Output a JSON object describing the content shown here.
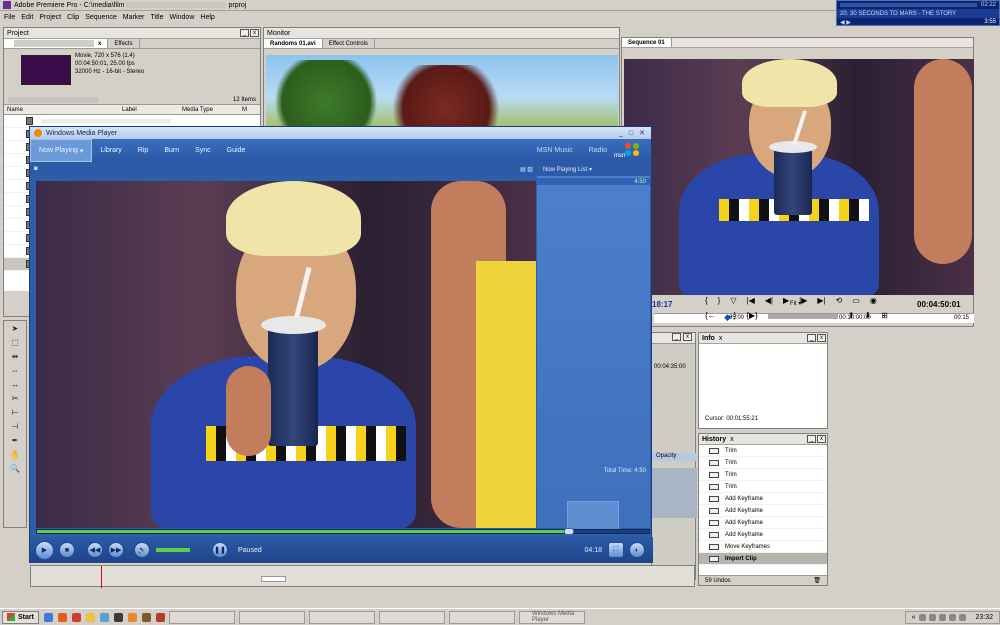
{
  "premiere": {
    "title": "Adobe Premiere Pro - C:\\media\\film",
    "title_tail": "prproj",
    "menu": [
      "File",
      "Edit",
      "Project",
      "Clip",
      "Sequence",
      "Marker",
      "Title",
      "Window",
      "Help"
    ]
  },
  "media_mini": {
    "now_playing": "20. 30 SECONDS TO MARS - THE STORY",
    "time": "3:55",
    "clock": "02:22"
  },
  "project": {
    "title": "Project",
    "tab_effects": "Effects",
    "clip_type": "Movie, 720 x 576 (1.4)",
    "clip_duration": "00:04:50:01, 25.00 fps",
    "clip_audio": "32000 Hz - 16-bit - Stereo",
    "items_count": "12 Items",
    "columns": {
      "name": "Name",
      "label": "Label",
      "media_type": "Media Type",
      "m": "M"
    }
  },
  "monitor": {
    "title": "Monitor",
    "tab_source": "Randoms 01.avi",
    "tab_effect_controls": "Effect Controls"
  },
  "sequence": {
    "tab": "Sequence 01",
    "current_tc": "18:17",
    "fit": "Fit",
    "duration_tc": "00:04:50:01",
    "ruler": [
      "05:00",
      "00:10:00:00",
      "00:15"
    ]
  },
  "timeline_small": {
    "tc": "00:04:35:00",
    "opacity": "Opacity"
  },
  "info": {
    "title": "Info",
    "cursor": "Cursor: 00:01:55:21"
  },
  "history": {
    "title": "History",
    "items": [
      "Trim",
      "Trim",
      "Trim",
      "Trim",
      "Add Keyframe",
      "Add Keyframe",
      "Add Keyframe",
      "Add Keyframe",
      "Move Keyframes",
      "Import Clip"
    ],
    "undos": "59 Undos"
  },
  "wmp": {
    "title": "Windows Media Player",
    "nav": [
      "Now Playing",
      "Library",
      "Rip",
      "Burn",
      "Sync",
      "Guide"
    ],
    "nav_right": [
      "MSN Music",
      "Radio"
    ],
    "msn": "msn",
    "now_playing_list": "Now Playing List",
    "item_time": "4:50",
    "total_time": "Total Time: 4:50",
    "status": "Paused",
    "time": "04:18",
    "progress": 0.87
  },
  "taskbar": {
    "start": "Start",
    "clock": "23:32"
  },
  "colors": {
    "wmp_blue": "#2f5ea9",
    "accent_green": "#57d24a",
    "premiere_purple": "#6a2c91"
  }
}
